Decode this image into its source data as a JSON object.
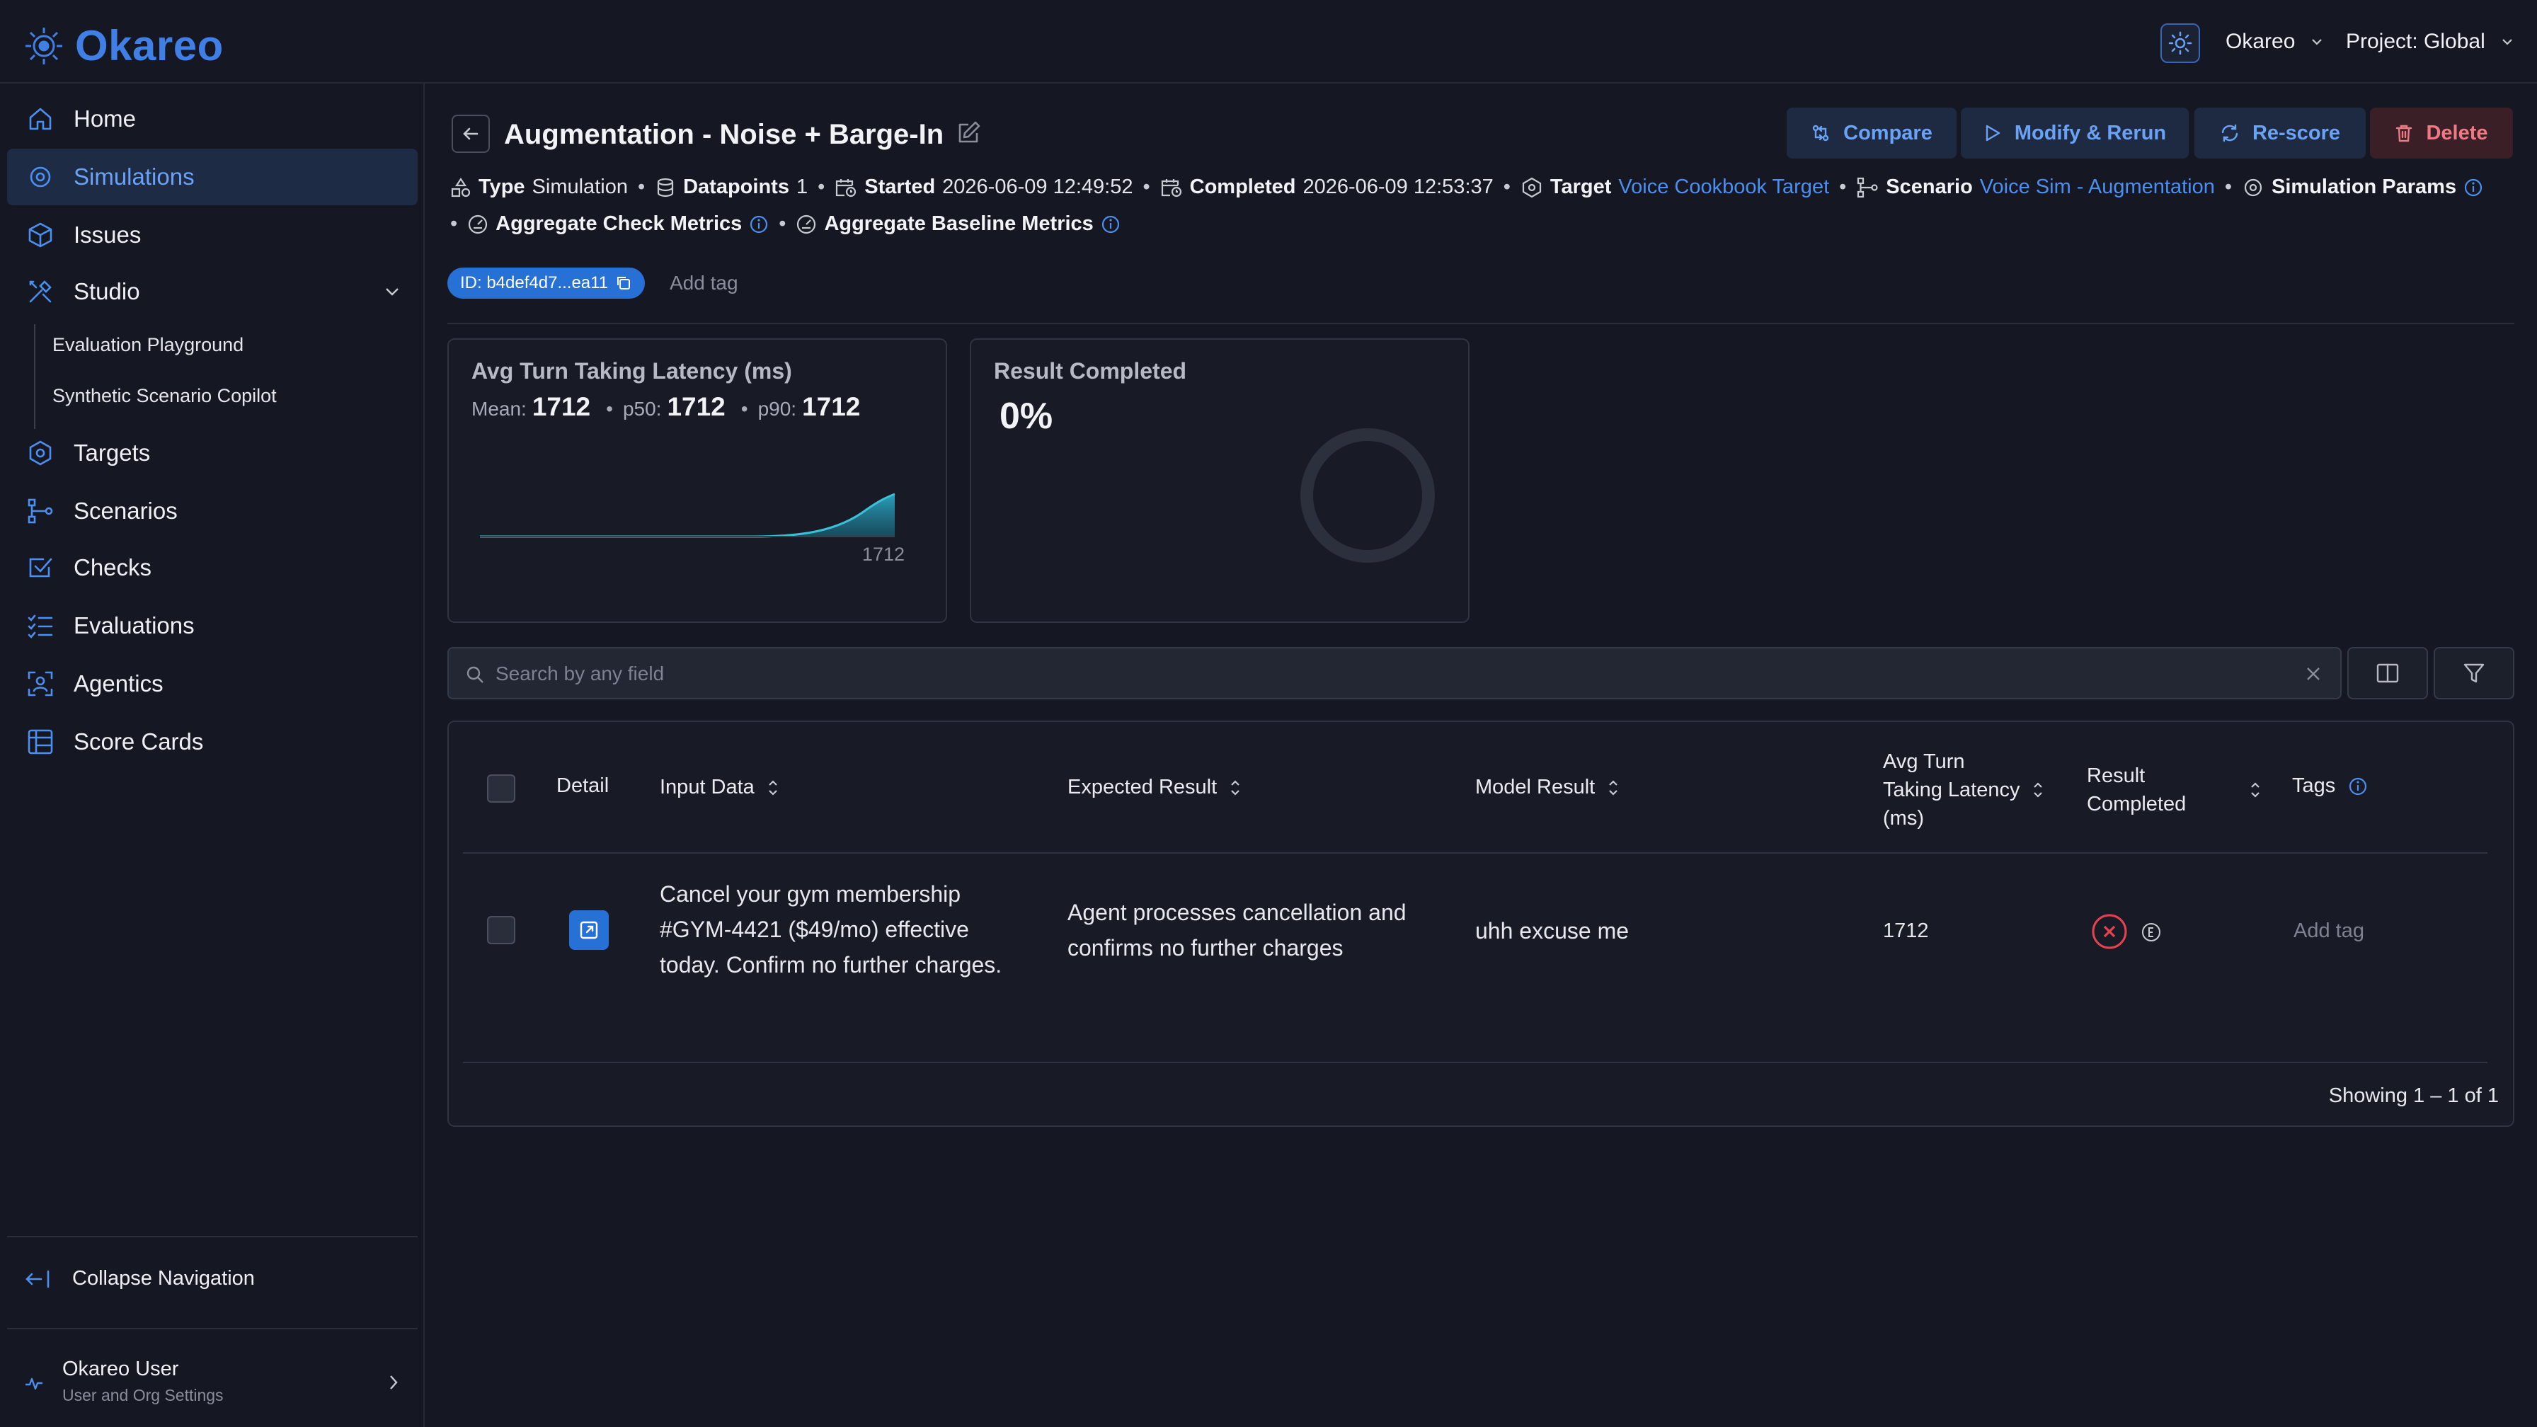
{
  "app": {
    "name": "Okareo"
  },
  "topbar": {
    "org": "Okareo",
    "project": "Project: Global"
  },
  "sidebar": {
    "items": [
      {
        "label": "Home"
      },
      {
        "label": "Simulations"
      },
      {
        "label": "Issues"
      },
      {
        "label": "Studio"
      },
      {
        "label": "Targets"
      },
      {
        "label": "Scenarios"
      },
      {
        "label": "Checks"
      },
      {
        "label": "Evaluations"
      },
      {
        "label": "Agentics"
      },
      {
        "label": "Score Cards"
      }
    ],
    "studio_sub": [
      {
        "label": "Evaluation Playground"
      },
      {
        "label": "Synthetic Scenario Copilot"
      }
    ],
    "collapse_label": "Collapse Navigation",
    "user": {
      "name": "Okareo User",
      "subtitle": "User and Org Settings"
    }
  },
  "page": {
    "title": "Augmentation - Noise + Barge-In",
    "actions": {
      "compare": "Compare",
      "modify": "Modify & Rerun",
      "rescore": "Re-score",
      "delete": "Delete"
    },
    "meta": {
      "type_label": "Type",
      "type_value": "Simulation",
      "datapoints_label": "Datapoints",
      "datapoints_value": "1",
      "started_label": "Started",
      "started_value": "2026-06-09 12:49:52",
      "completed_label": "Completed",
      "completed_value": "2026-06-09 12:53:37",
      "target_label": "Target",
      "target_value": "Voice Cookbook Target",
      "scenario_label": "Scenario",
      "scenario_value": "Voice Sim - Augmentation",
      "sim_params_label": "Simulation Params",
      "agg_check_label": "Aggregate Check Metrics",
      "agg_baseline_label": "Aggregate Baseline Metrics"
    },
    "id_chip": "ID: b4def4d7...ea11",
    "add_tag": "Add tag"
  },
  "cards": {
    "latency": {
      "title": "Avg Turn Taking Latency (ms)",
      "mean_label": "Mean:",
      "mean": "1712",
      "p50_label": "p50:",
      "p50": "1712",
      "p90_label": "p90:",
      "p90": "1712",
      "axis_label": "1712"
    },
    "result": {
      "title": "Result Completed",
      "value": "0%"
    }
  },
  "search": {
    "placeholder": "Search by any field"
  },
  "table": {
    "headers": {
      "detail": "Detail",
      "input": "Input Data",
      "expected": "Expected Result",
      "model": "Model Result",
      "latency_1": "Avg Turn",
      "latency_2": "Taking Latency",
      "latency_3": "(ms)",
      "result_1": "Result",
      "result_2": "Completed",
      "tags": "Tags"
    },
    "rows": [
      {
        "input_1": "Cancel your gym membership",
        "input_2": "#GYM-4421 ($49/mo) effective",
        "input_3": "today. Confirm no further charges.",
        "expected_1": "Agent processes cancellation and",
        "expected_2": "confirms no further charges",
        "model": "uhh excuse me",
        "latency": "1712",
        "add_tag": "Add tag"
      }
    ],
    "footer": "Showing 1 – 1 of 1"
  },
  "colors": {
    "accent": "#4b8ff0",
    "brand": "#3f7fe6",
    "danger": "#e8414f",
    "background": "#151823"
  }
}
